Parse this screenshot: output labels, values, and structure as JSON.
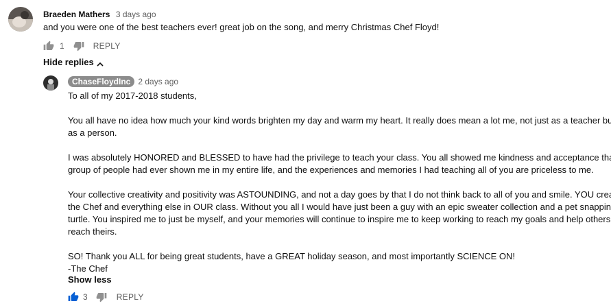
{
  "comment": {
    "author": "Braeden Mathers",
    "time": "3 days ago",
    "text": "and you were one of the best teachers ever! great job on the song, and merry Christmas Chef Floyd!",
    "likes": "1",
    "reply_label": "REPLY",
    "hide_replies_label": "Hide replies",
    "avatar_icon": "user-avatar-icon"
  },
  "reply": {
    "author": "ChaseFloydInc",
    "time": "2 days ago",
    "lines": [
      "To all of my 2017-2018 students,",
      "",
      "You all have no idea how much your kind words brighten my day and warm my heart. It really does mean a lot me, not just as a teacher but",
      "as a person.",
      "",
      "I was absolutely HONORED and BLESSED to have had the privilege to teach your class.  You all showed me kindness and acceptance that no",
      "group of people had ever shown me in my entire life,  and the experiences and memories I had teaching all of you are priceless to me.",
      "",
      "Your collective creativity and positivity was ASTOUNDING, and not a day goes by that I do not think back to all of you and smile. YOU created",
      "the Chef and everything else in OUR class. Without you all I would have just been a guy with an epic sweater collection and a pet snapping",
      "turtle. You inspired me to just be myself, and your memories will continue to inspire me to keep working to reach my goals and help others",
      "reach theirs.",
      "",
      "SO! Thank you ALL for being great students, have a GREAT holiday season, and most importantly SCIENCE ON!",
      "-The Chef"
    ],
    "show_less_label": "Show less",
    "likes": "3",
    "reply_label": "REPLY",
    "like_color": "#065fd4"
  }
}
